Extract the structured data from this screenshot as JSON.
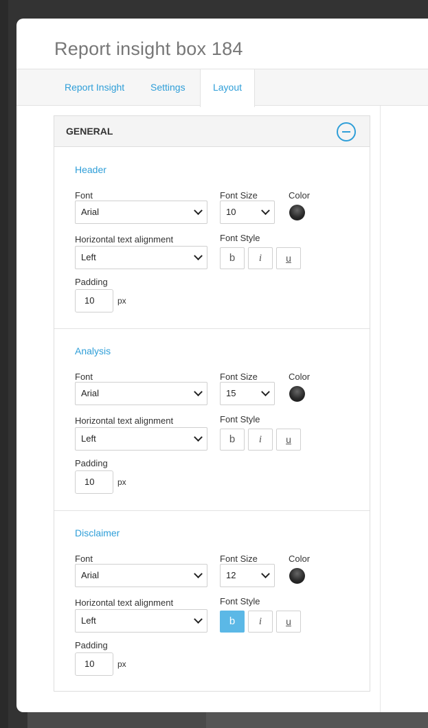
{
  "modal": {
    "title": "Report insight box 184"
  },
  "tabs": [
    {
      "label": "Report Insight"
    },
    {
      "label": "Settings"
    },
    {
      "label": "Layout"
    }
  ],
  "panel": {
    "title": "GENERAL"
  },
  "labels": {
    "font": "Font",
    "font_size": "Font Size",
    "color": "Color",
    "alignment": "Horizontal text alignment",
    "font_style": "Font Style",
    "padding": "Padding",
    "unit": "px",
    "bold_glyph": "b",
    "italic_glyph": "i",
    "underline_glyph": "u"
  },
  "sections": [
    {
      "title": "Header",
      "font": "Arial",
      "font_size": "10",
      "color": "#2b2b2b",
      "alignment": "Left",
      "bold": false,
      "italic": false,
      "underline": false,
      "padding": "10"
    },
    {
      "title": "Analysis",
      "font": "Arial",
      "font_size": "15",
      "color": "#2b2b2b",
      "alignment": "Left",
      "bold": false,
      "italic": false,
      "underline": false,
      "padding": "10"
    },
    {
      "title": "Disclaimer",
      "font": "Arial",
      "font_size": "12",
      "color": "#2b2b2b",
      "alignment": "Left",
      "bold": true,
      "italic": false,
      "underline": false,
      "padding": "10"
    }
  ],
  "colors": {
    "accent": "#2e9ed8",
    "active_button": "#5bb8e6"
  }
}
